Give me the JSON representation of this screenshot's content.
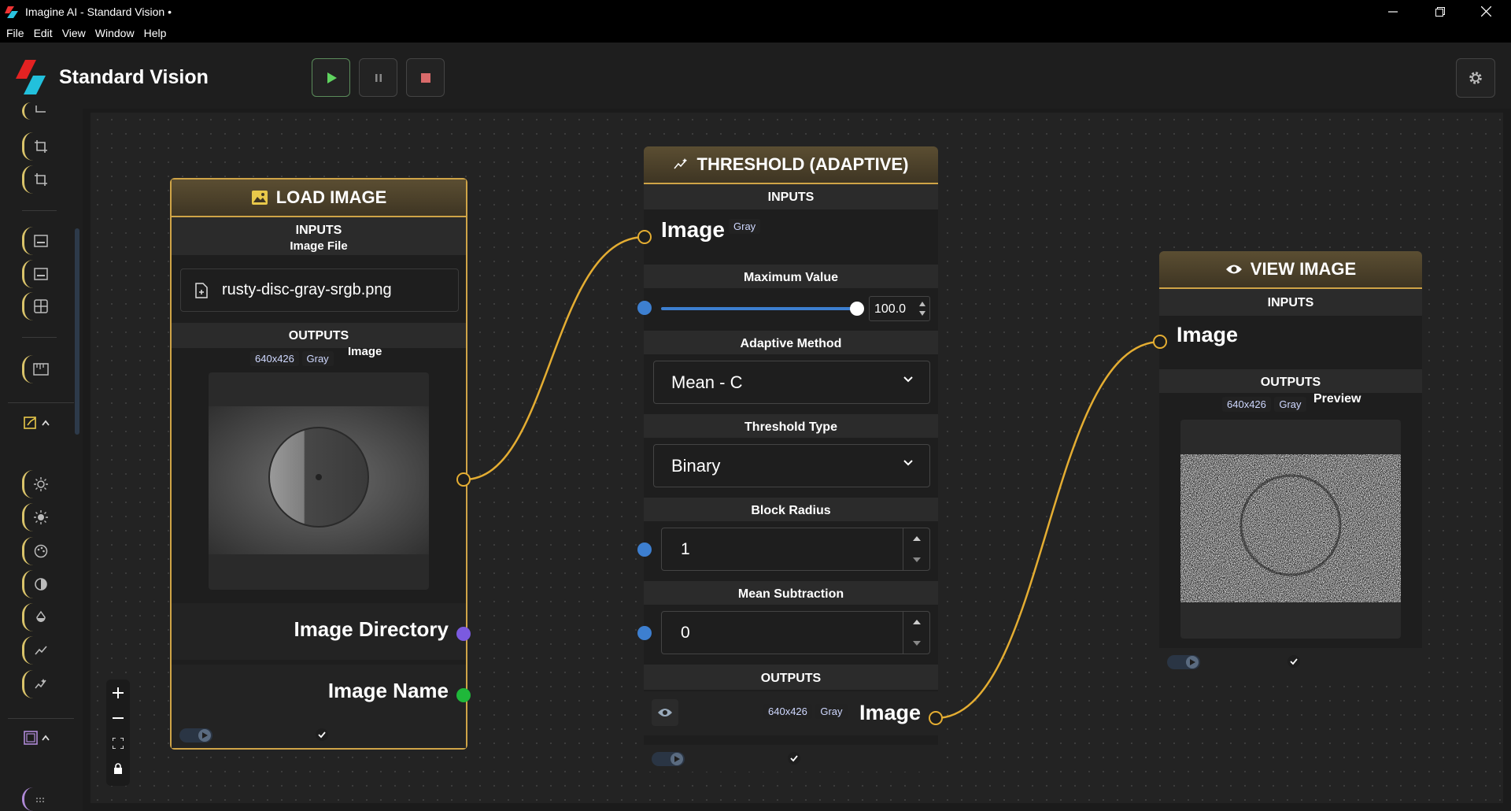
{
  "window": {
    "title": "Imagine AI - Standard Vision •",
    "controls": [
      "minimize-icon",
      "restore-icon",
      "close-icon"
    ]
  },
  "menu": {
    "items": [
      "File",
      "Edit",
      "View",
      "Window",
      "Help"
    ]
  },
  "header": {
    "app_name": "Standard Vision",
    "buttons": [
      "play-icon",
      "pause-icon",
      "stop-icon",
      "gear-icon"
    ]
  },
  "colors": {
    "accent": "#cfa447",
    "node_header": "#4e4329",
    "port_blue": "#3d7fd0",
    "port_purple": "#7b5ae0",
    "port_green": "#1fb83a",
    "play_green": "#5fd35f"
  },
  "nodes": {
    "load": {
      "title": "LOAD IMAGE",
      "icon": "image-icon",
      "inputs_label": "INPUTS",
      "file_label": "Image File",
      "file_name": "rusty-disc-gray-srgb.png",
      "outputs_label": "OUTPUTS",
      "res": "640x426",
      "mode": "Gray",
      "image_label": "Image",
      "out_dir": "Image Directory",
      "out_name": "Image Name"
    },
    "threshold": {
      "title": "THRESHOLD (ADAPTIVE)",
      "icon": "threshold-icon",
      "inputs_label": "INPUTS",
      "in_image": "Image",
      "in_mode": "Gray",
      "max_label": "Maximum Value",
      "max_value": "100.0",
      "max_fraction": 1.0,
      "method_label": "Adaptive Method",
      "method_value": "Mean - C",
      "type_label": "Threshold Type",
      "type_value": "Binary",
      "radius_label": "Block Radius",
      "radius_value": "1",
      "sub_label": "Mean Subtraction",
      "sub_value": "0",
      "outputs_label": "OUTPUTS",
      "res": "640x426",
      "mode": "Gray",
      "out_image": "Image"
    },
    "view": {
      "title": "VIEW IMAGE",
      "icon": "eye-icon",
      "inputs_label": "INPUTS",
      "in_image": "Image",
      "outputs_label": "OUTPUTS",
      "res": "640x426",
      "mode": "Gray",
      "preview_label": "Preview"
    }
  }
}
